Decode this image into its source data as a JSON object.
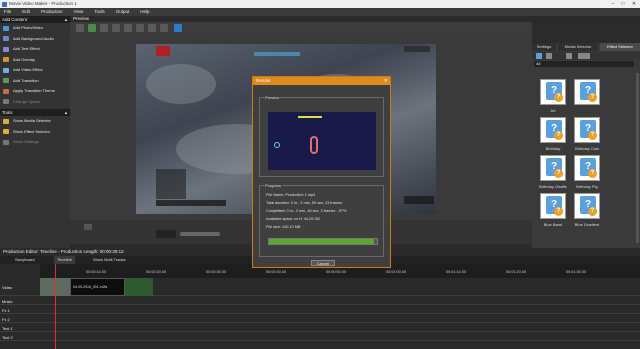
{
  "window": {
    "title": "Movie Video Maker - Production 1"
  },
  "menu": [
    "File",
    "Edit",
    "Production",
    "View",
    "Tools",
    "Output",
    "Help"
  ],
  "left": {
    "add_content": {
      "header": "Add Content",
      "items": [
        {
          "label": "Add Photo/Video",
          "color": "#4a9ad8"
        },
        {
          "label": "Add Background Audio",
          "color": "#6a8ad0"
        },
        {
          "label": "Add Text Effect",
          "color": "#8888cc"
        },
        {
          "label": "Add Overlay",
          "color": "#d89030"
        },
        {
          "label": "Add Video Effect",
          "color": "#6ab0e0"
        },
        {
          "label": "Add Transition",
          "color": "#5a9a5a"
        },
        {
          "label": "Apply Transition Theme",
          "color": "#c07040"
        },
        {
          "label": "Change Speed",
          "color": "#777777",
          "dim": true
        }
      ]
    },
    "tools": {
      "header": "Tools",
      "items": [
        {
          "label": "Show Media Selector",
          "color": "#d8b040"
        },
        {
          "label": "Show Effect Selector",
          "color": "#d8b040"
        },
        {
          "label": "Show Settings",
          "color": "#777777",
          "dim": true
        }
      ]
    }
  },
  "preview": {
    "header": "Preview"
  },
  "right": {
    "tabs": [
      "Settings",
      "Media Selector",
      "Effect Selector"
    ],
    "filter": "All",
    "effects": [
      "Art",
      "",
      "Birthday",
      "Birthday Cow",
      "Birthday Giraffe",
      "Birthday Pig",
      "Blue Band",
      "Blue Gradient"
    ]
  },
  "timeline": {
    "header": "Production Editor: Timeline - Production Length: 00:00:29:12",
    "tabs": [
      "Storyboard",
      "Timeline",
      "Show Multi Tracks"
    ],
    "ticks": [
      "00:00:10.00",
      "00:00:20.00",
      "00:00:30.00",
      "00:00:40.00",
      "00:00:50.00",
      "00:01:00.00",
      "00:01:10.00",
      "00:01:20.00",
      "00:01:30.00"
    ],
    "tracks": [
      "Video",
      "Music",
      "Fx 1",
      "Fx 2",
      "Text 1",
      "Text 2"
    ],
    "clip_label": "04-09-2016_001.m2ts"
  },
  "dialog": {
    "title": "Render",
    "preview_label": "Preview",
    "progress_label": "Progress",
    "file_name": "File Name: Production 1.mp4",
    "total_duration": "Total duration: 0 hr., 2 min, 50 sec, 23 frames",
    "completed": "Completed: 0 hr., 2 min, 46 sec, 3 frames - 97%",
    "available_space": "Available space on H:  44.29 GB",
    "file_size": "File size: 140.13 MB",
    "progress": 0.97,
    "cancel": "Cancel"
  },
  "colors": {
    "accent": "#e08a1e",
    "progress": "#5aa82e"
  }
}
